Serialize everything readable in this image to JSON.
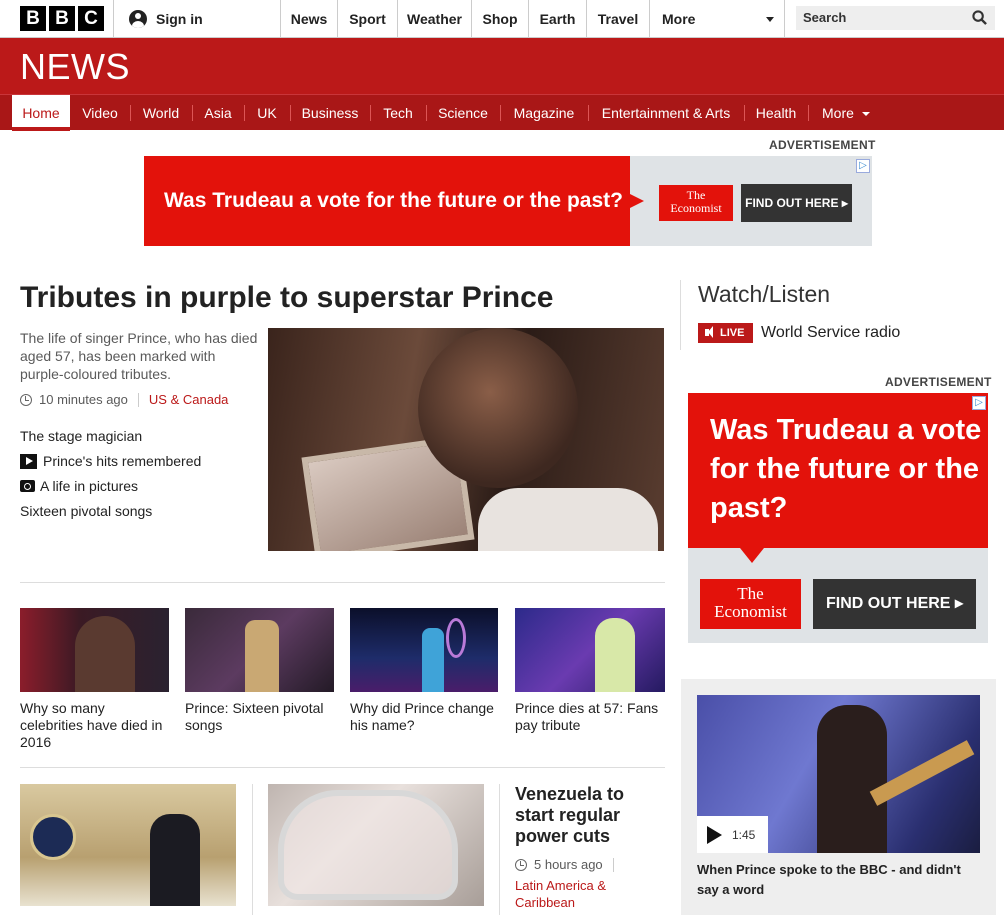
{
  "global_bar": {
    "logo_letters": [
      "B",
      "B",
      "C"
    ],
    "sign_in": "Sign in",
    "nav": [
      "News",
      "Sport",
      "Weather",
      "Shop",
      "Earth",
      "Travel",
      "More"
    ],
    "search_placeholder": "Search"
  },
  "news_header": {
    "title": "NEWS",
    "nav": [
      "Home",
      "Video",
      "World",
      "Asia",
      "UK",
      "Business",
      "Tech",
      "Science",
      "Magazine",
      "Entertainment & Arts",
      "Health",
      "More"
    ],
    "active": "Home"
  },
  "ads": {
    "label": "ADVERTISEMENT",
    "banner_text": "Was Trudeau a vote for the future or the past?",
    "economist_line1": "The",
    "economist_line2": "Economist",
    "cta": "FIND OUT HERE",
    "choices_icon": "adchoices-icon"
  },
  "main_story": {
    "headline": "Tributes in purple to superstar Prince",
    "summary": "The life of singer Prince, who has died aged 57, has been marked with purple-coloured tributes.",
    "time": "10 minutes ago",
    "section": "US & Canada",
    "related": [
      {
        "label": "The stage magician",
        "icon": ""
      },
      {
        "label": "Prince's hits remembered",
        "icon": "play-icon"
      },
      {
        "label": "A life in pictures",
        "icon": "camera-icon"
      },
      {
        "label": "Sixteen pivotal songs",
        "icon": ""
      }
    ]
  },
  "story_row": [
    {
      "caption": "Why so many celebrities have died in 2016"
    },
    {
      "caption": "Prince: Sixteen pivotal songs"
    },
    {
      "caption": "Why did Prince change his name?"
    },
    {
      "caption": "Prince dies at 57: Fans pay tribute"
    }
  ],
  "bottom_story": {
    "headline": "Venezuela to start regular power cuts",
    "time": "5 hours ago",
    "section": "Latin America & Caribbean"
  },
  "watch_listen": {
    "title": "Watch/Listen",
    "live_badge": "LIVE",
    "radio": "World Service radio",
    "video_duration": "1:45",
    "video_caption": "When Prince spoke to the BBC - and didn't say a word"
  },
  "colors": {
    "bbc_red": "#bb1919",
    "nav_red": "#a91717",
    "economist_red": "#e3120b"
  }
}
